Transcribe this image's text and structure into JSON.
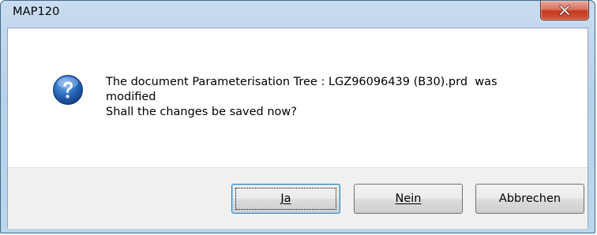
{
  "window": {
    "title": "MAP120"
  },
  "message": {
    "line1": "The document Parameterisation Tree : LGZ96096439 (B30).prd  was",
    "line2": "modified",
    "line3": "Shall the changes be saved now?",
    "icon": "question-icon"
  },
  "buttons": {
    "yes_label": "Ja",
    "no_label": "Nein",
    "cancel_label": "Abbrechen"
  },
  "close_icon": "close-icon",
  "colors": {
    "close_button": "#c4391e",
    "icon_blue": "#1f5fb3",
    "frame": "#b9d1ea",
    "button_area": "#f0f0f0"
  }
}
